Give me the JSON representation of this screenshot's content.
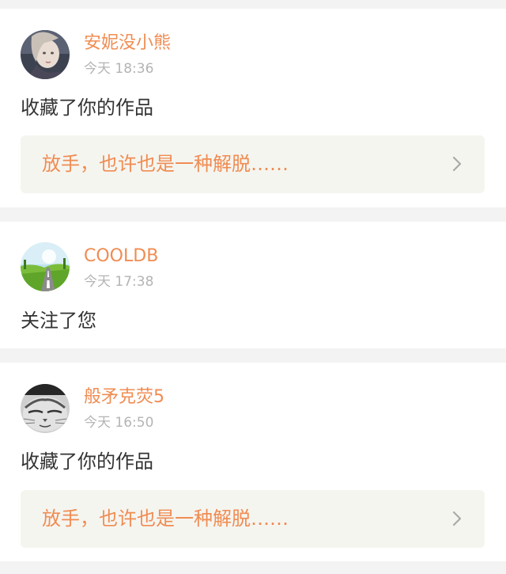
{
  "notifications": [
    {
      "username": "安妮没小熊",
      "timestamp": "今天 18:36",
      "action": "收藏了你的作品",
      "work_title": "放手，也许也是一种解脱……",
      "avatar_icon": "portrait-woman-avatar"
    },
    {
      "username": "COOLDB",
      "timestamp": "今天 17:38",
      "action": "关注了您",
      "avatar_icon": "landscape-road-avatar"
    },
    {
      "username": "般矛克荧5",
      "timestamp": "今天 16:50",
      "action": "收藏了你的作品",
      "work_title": "放手，也许也是一种解脱……",
      "avatar_icon": "cat-face-avatar"
    }
  ],
  "colors": {
    "accent": "#f08c52",
    "timestamp": "#b4b4b4",
    "body_text": "#333333",
    "card_bg": "#ffffff",
    "page_bg": "#f3f3f3",
    "work_box_bg": "#f5f5f0"
  }
}
